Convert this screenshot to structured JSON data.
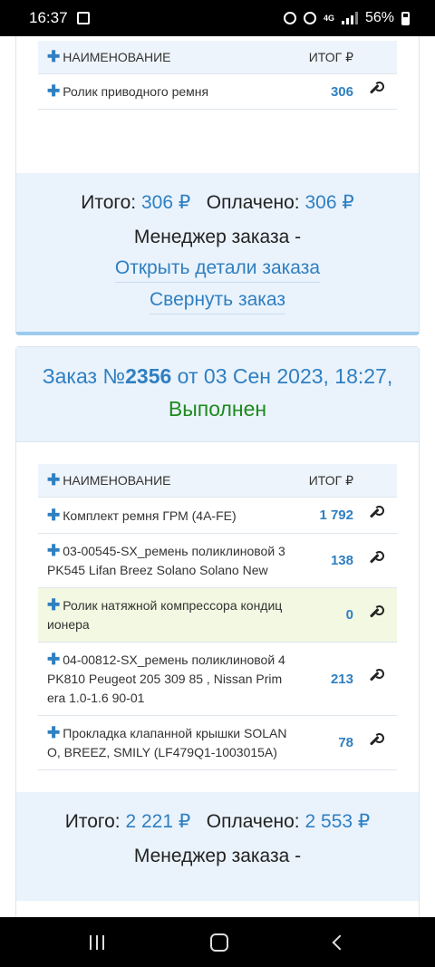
{
  "status_bar": {
    "time": "16:37",
    "network": "4G",
    "battery": "56%"
  },
  "table_header": {
    "name": "НАИМЕНОВАНИЕ",
    "total": "ИТОГ ₽"
  },
  "prev_order": {
    "items": [
      {
        "name": "Ролик приводного ремня",
        "total": "306"
      }
    ],
    "summary": {
      "total_label": "Итого:",
      "total_value": "306 ₽",
      "paid_label": "Оплачено:",
      "paid_value": "306 ₽",
      "manager": "Менеджер заказа -",
      "details_link": "Открыть детали заказа",
      "collapse_link": "Свернуть заказ"
    }
  },
  "order": {
    "title_prefix": "Заказ №",
    "number": "2356",
    "title_middle": " от 03 Сен 2023, 18:27, ",
    "status": "Выполнен",
    "items": [
      {
        "name": "Комплект ремня ГРМ (4A-FE)",
        "total": "1 792"
      },
      {
        "name": "03-00545-SX_ремень поликлиновой 3PK545 Lifan Breez Solano Solano New",
        "total": "138"
      },
      {
        "name": "Ролик натяжной компрессора кондиционера",
        "total": "0"
      },
      {
        "name": "04-00812-SX_ремень поликлиновой 4PK810 Peugeot 205 309 85 , Nissan Primera 1.0-1.6 90-01",
        "total": "213"
      },
      {
        "name": "Прокладка клапанной крышки SOLANO, BREEZ, SMILY (LF479Q1-1003015A)",
        "total": "78"
      }
    ],
    "summary": {
      "total_label": "Итого:",
      "total_value": "2 221 ₽",
      "paid_label": "Оплачено:",
      "paid_value": "2 553 ₽",
      "manager": "Менеджер заказа -"
    }
  },
  "colors": {
    "accent": "#2f7fc1",
    "status_done": "#1e8a1e",
    "panel": "#eaf3fc",
    "highlight_row": "#f2f8e2"
  }
}
